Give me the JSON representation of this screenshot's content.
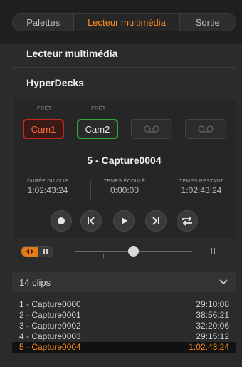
{
  "tabs": [
    "Palettes",
    "Lecteur multimédia",
    "Sortie"
  ],
  "sections": {
    "media_player": "Lecteur multimédia",
    "hyperdecks": "HyperDecks"
  },
  "decks": [
    {
      "status": "PRÊT",
      "label": "Cam1",
      "state": "recording"
    },
    {
      "status": "PRÊT",
      "label": "Cam2",
      "state": "ready"
    },
    {
      "status": "",
      "label": "",
      "state": "empty"
    },
    {
      "status": "",
      "label": "",
      "state": "empty"
    }
  ],
  "current_clip": "5 - Capture0004",
  "stats": [
    {
      "label": "DURÉE DU CLIP",
      "value": "1:02:43:24"
    },
    {
      "label": "TEMPS ÉCOULÉ",
      "value": "0:00:00"
    },
    {
      "label": "TEMPS RESTANT",
      "value": "1:02:43:24"
    }
  ],
  "controls": [
    "record-icon",
    "previous-icon",
    "play-icon",
    "next-icon",
    "loop-icon"
  ],
  "clips_summary": "14 clips",
  "clips": [
    {
      "name": "1 - Capture0000",
      "duration": "29:10:08"
    },
    {
      "name": "2 - Capture0001",
      "duration": "38:56:21"
    },
    {
      "name": "3 - Capture0002",
      "duration": "32:20:06"
    },
    {
      "name": "4 - Capture0003",
      "duration": "29:15:12"
    },
    {
      "name": "5 - Capture0004",
      "duration": "1:02:43:24"
    }
  ],
  "colors": {
    "accent": "#ff8a1e",
    "record_red": "#c2291c",
    "ready_green": "#2ea73a"
  }
}
